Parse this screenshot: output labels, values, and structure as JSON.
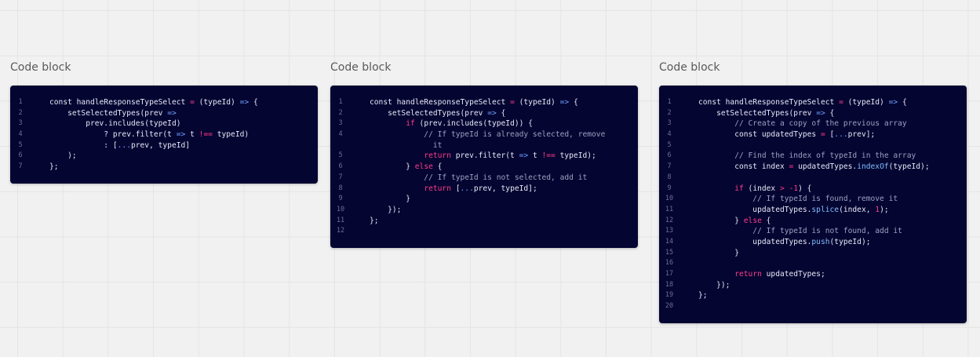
{
  "colors": {
    "canvas_bg": "#f1f1f1",
    "card_bg": "#050532",
    "keyword": "#ff3b87",
    "operator": "#6ea0ff",
    "function": "#7fbfff",
    "comment": "#9aa0bf",
    "text": "#e6e8f6",
    "line_number": "#6b6e96"
  },
  "blocks": [
    {
      "title": "Code block",
      "lines": [
        {
          "n": "1",
          "tokens": [
            {
              "t": "const handleResponseTypeSelect ",
              "c": "text"
            },
            {
              "t": "=",
              "c": "kw"
            },
            {
              "t": " (typeId) ",
              "c": "text"
            },
            {
              "t": "=>",
              "c": "op"
            },
            {
              "t": " {",
              "c": "text"
            }
          ]
        },
        {
          "n": "2",
          "tokens": [
            {
              "t": "    setSelectedTypes(prev ",
              "c": "text"
            },
            {
              "t": "=>",
              "c": "op"
            }
          ]
        },
        {
          "n": "3",
          "tokens": [
            {
              "t": "        prev.includes(typeId)",
              "c": "text"
            }
          ]
        },
        {
          "n": "4",
          "tokens": [
            {
              "t": "            ? prev.filter(t ",
              "c": "text"
            },
            {
              "t": "=>",
              "c": "op"
            },
            {
              "t": " t ",
              "c": "text"
            },
            {
              "t": "!==",
              "c": "kw"
            },
            {
              "t": " typeId)",
              "c": "text"
            }
          ]
        },
        {
          "n": "5",
          "tokens": [
            {
              "t": "            : [",
              "c": "text"
            },
            {
              "t": "...",
              "c": "op"
            },
            {
              "t": "prev, typeId]",
              "c": "text"
            }
          ]
        },
        {
          "n": "6",
          "tokens": [
            {
              "t": "    );",
              "c": "text"
            }
          ]
        },
        {
          "n": "7",
          "tokens": [
            {
              "t": "};",
              "c": "text"
            }
          ]
        }
      ]
    },
    {
      "title": "Code block",
      "lines": [
        {
          "n": "1",
          "tokens": [
            {
              "t": "const handleResponseTypeSelect ",
              "c": "text"
            },
            {
              "t": "=",
              "c": "kw"
            },
            {
              "t": " (typeId) ",
              "c": "text"
            },
            {
              "t": "=>",
              "c": "op"
            },
            {
              "t": " {",
              "c": "text"
            }
          ]
        },
        {
          "n": "2",
          "tokens": [
            {
              "t": "    setSelectedTypes(prev ",
              "c": "text"
            },
            {
              "t": "=>",
              "c": "op"
            },
            {
              "t": " {",
              "c": "text"
            }
          ]
        },
        {
          "n": "3",
          "tokens": [
            {
              "t": "        ",
              "c": "text"
            },
            {
              "t": "if",
              "c": "kw"
            },
            {
              "t": " (prev.includes(typeId)) {",
              "c": "text"
            }
          ]
        },
        {
          "n": "4",
          "tokens": [
            {
              "t": "            // If typeId is already selected, remove",
              "c": "comment"
            }
          ]
        },
        {
          "n": "",
          "tokens": [
            {
              "t": "              it",
              "c": "comment"
            }
          ]
        },
        {
          "n": "5",
          "tokens": [
            {
              "t": "            ",
              "c": "text"
            },
            {
              "t": "return",
              "c": "kw"
            },
            {
              "t": " prev.filter(t ",
              "c": "text"
            },
            {
              "t": "=>",
              "c": "op"
            },
            {
              "t": " t ",
              "c": "text"
            },
            {
              "t": "!==",
              "c": "kw"
            },
            {
              "t": " typeId);",
              "c": "text"
            }
          ]
        },
        {
          "n": "6",
          "tokens": [
            {
              "t": "        } ",
              "c": "text"
            },
            {
              "t": "else",
              "c": "kw"
            },
            {
              "t": " {",
              "c": "text"
            }
          ]
        },
        {
          "n": "7",
          "tokens": [
            {
              "t": "            // If typeId is not selected, add it",
              "c": "comment"
            }
          ]
        },
        {
          "n": "8",
          "tokens": [
            {
              "t": "            ",
              "c": "text"
            },
            {
              "t": "return",
              "c": "kw"
            },
            {
              "t": " [",
              "c": "text"
            },
            {
              "t": "...",
              "c": "op"
            },
            {
              "t": "prev, typeId];",
              "c": "text"
            }
          ]
        },
        {
          "n": "9",
          "tokens": [
            {
              "t": "        }",
              "c": "text"
            }
          ]
        },
        {
          "n": "10",
          "tokens": [
            {
              "t": "    });",
              "c": "text"
            }
          ]
        },
        {
          "n": "11",
          "tokens": [
            {
              "t": "};",
              "c": "text"
            }
          ]
        },
        {
          "n": "12",
          "tokens": []
        }
      ]
    },
    {
      "title": "Code block",
      "lines": [
        {
          "n": "1",
          "tokens": [
            {
              "t": "const handleResponseTypeSelect ",
              "c": "text"
            },
            {
              "t": "=",
              "c": "kw"
            },
            {
              "t": " (typeId) ",
              "c": "text"
            },
            {
              "t": "=>",
              "c": "op"
            },
            {
              "t": " {",
              "c": "text"
            }
          ]
        },
        {
          "n": "2",
          "tokens": [
            {
              "t": "    setSelectedTypes(prev ",
              "c": "text"
            },
            {
              "t": "=>",
              "c": "op"
            },
            {
              "t": " {",
              "c": "text"
            }
          ]
        },
        {
          "n": "3",
          "tokens": [
            {
              "t": "        // Create a copy of the previous array",
              "c": "comment"
            }
          ]
        },
        {
          "n": "4",
          "tokens": [
            {
              "t": "        const updatedTypes ",
              "c": "text"
            },
            {
              "t": "=",
              "c": "kw"
            },
            {
              "t": " [",
              "c": "text"
            },
            {
              "t": "...",
              "c": "op"
            },
            {
              "t": "prev];",
              "c": "text"
            }
          ]
        },
        {
          "n": "5",
          "tokens": []
        },
        {
          "n": "6",
          "tokens": [
            {
              "t": "        // Find the index of typeId in the array",
              "c": "comment"
            }
          ]
        },
        {
          "n": "7",
          "tokens": [
            {
              "t": "        const index ",
              "c": "text"
            },
            {
              "t": "=",
              "c": "kw"
            },
            {
              "t": " updatedTypes.",
              "c": "text"
            },
            {
              "t": "indexOf",
              "c": "fn"
            },
            {
              "t": "(typeId);",
              "c": "text"
            }
          ]
        },
        {
          "n": "8",
          "tokens": []
        },
        {
          "n": "9",
          "tokens": [
            {
              "t": "        ",
              "c": "text"
            },
            {
              "t": "if",
              "c": "kw"
            },
            {
              "t": " (index ",
              "c": "text"
            },
            {
              "t": ">",
              "c": "kw"
            },
            {
              "t": " ",
              "c": "text"
            },
            {
              "t": "-1",
              "c": "kw"
            },
            {
              "t": ") {",
              "c": "text"
            }
          ]
        },
        {
          "n": "10",
          "tokens": [
            {
              "t": "            // If typeId is found, remove it",
              "c": "comment"
            }
          ]
        },
        {
          "n": "11",
          "tokens": [
            {
              "t": "            updatedTypes.",
              "c": "text"
            },
            {
              "t": "splice",
              "c": "fn"
            },
            {
              "t": "(index, ",
              "c": "text"
            },
            {
              "t": "1",
              "c": "kw"
            },
            {
              "t": ");",
              "c": "text"
            }
          ]
        },
        {
          "n": "12",
          "tokens": [
            {
              "t": "        } ",
              "c": "text"
            },
            {
              "t": "else",
              "c": "kw"
            },
            {
              "t": " {",
              "c": "text"
            }
          ]
        },
        {
          "n": "13",
          "tokens": [
            {
              "t": "            // If typeId is not found, add it",
              "c": "comment"
            }
          ]
        },
        {
          "n": "14",
          "tokens": [
            {
              "t": "            updatedTypes.",
              "c": "text"
            },
            {
              "t": "push",
              "c": "fn"
            },
            {
              "t": "(typeId);",
              "c": "text"
            }
          ]
        },
        {
          "n": "15",
          "tokens": [
            {
              "t": "        }",
              "c": "text"
            }
          ]
        },
        {
          "n": "16",
          "tokens": []
        },
        {
          "n": "17",
          "tokens": [
            {
              "t": "        ",
              "c": "text"
            },
            {
              "t": "return",
              "c": "kw"
            },
            {
              "t": " updatedTypes;",
              "c": "text"
            }
          ]
        },
        {
          "n": "18",
          "tokens": [
            {
              "t": "    });",
              "c": "text"
            }
          ]
        },
        {
          "n": "19",
          "tokens": [
            {
              "t": "};",
              "c": "text"
            }
          ]
        },
        {
          "n": "20",
          "tokens": []
        }
      ]
    }
  ]
}
